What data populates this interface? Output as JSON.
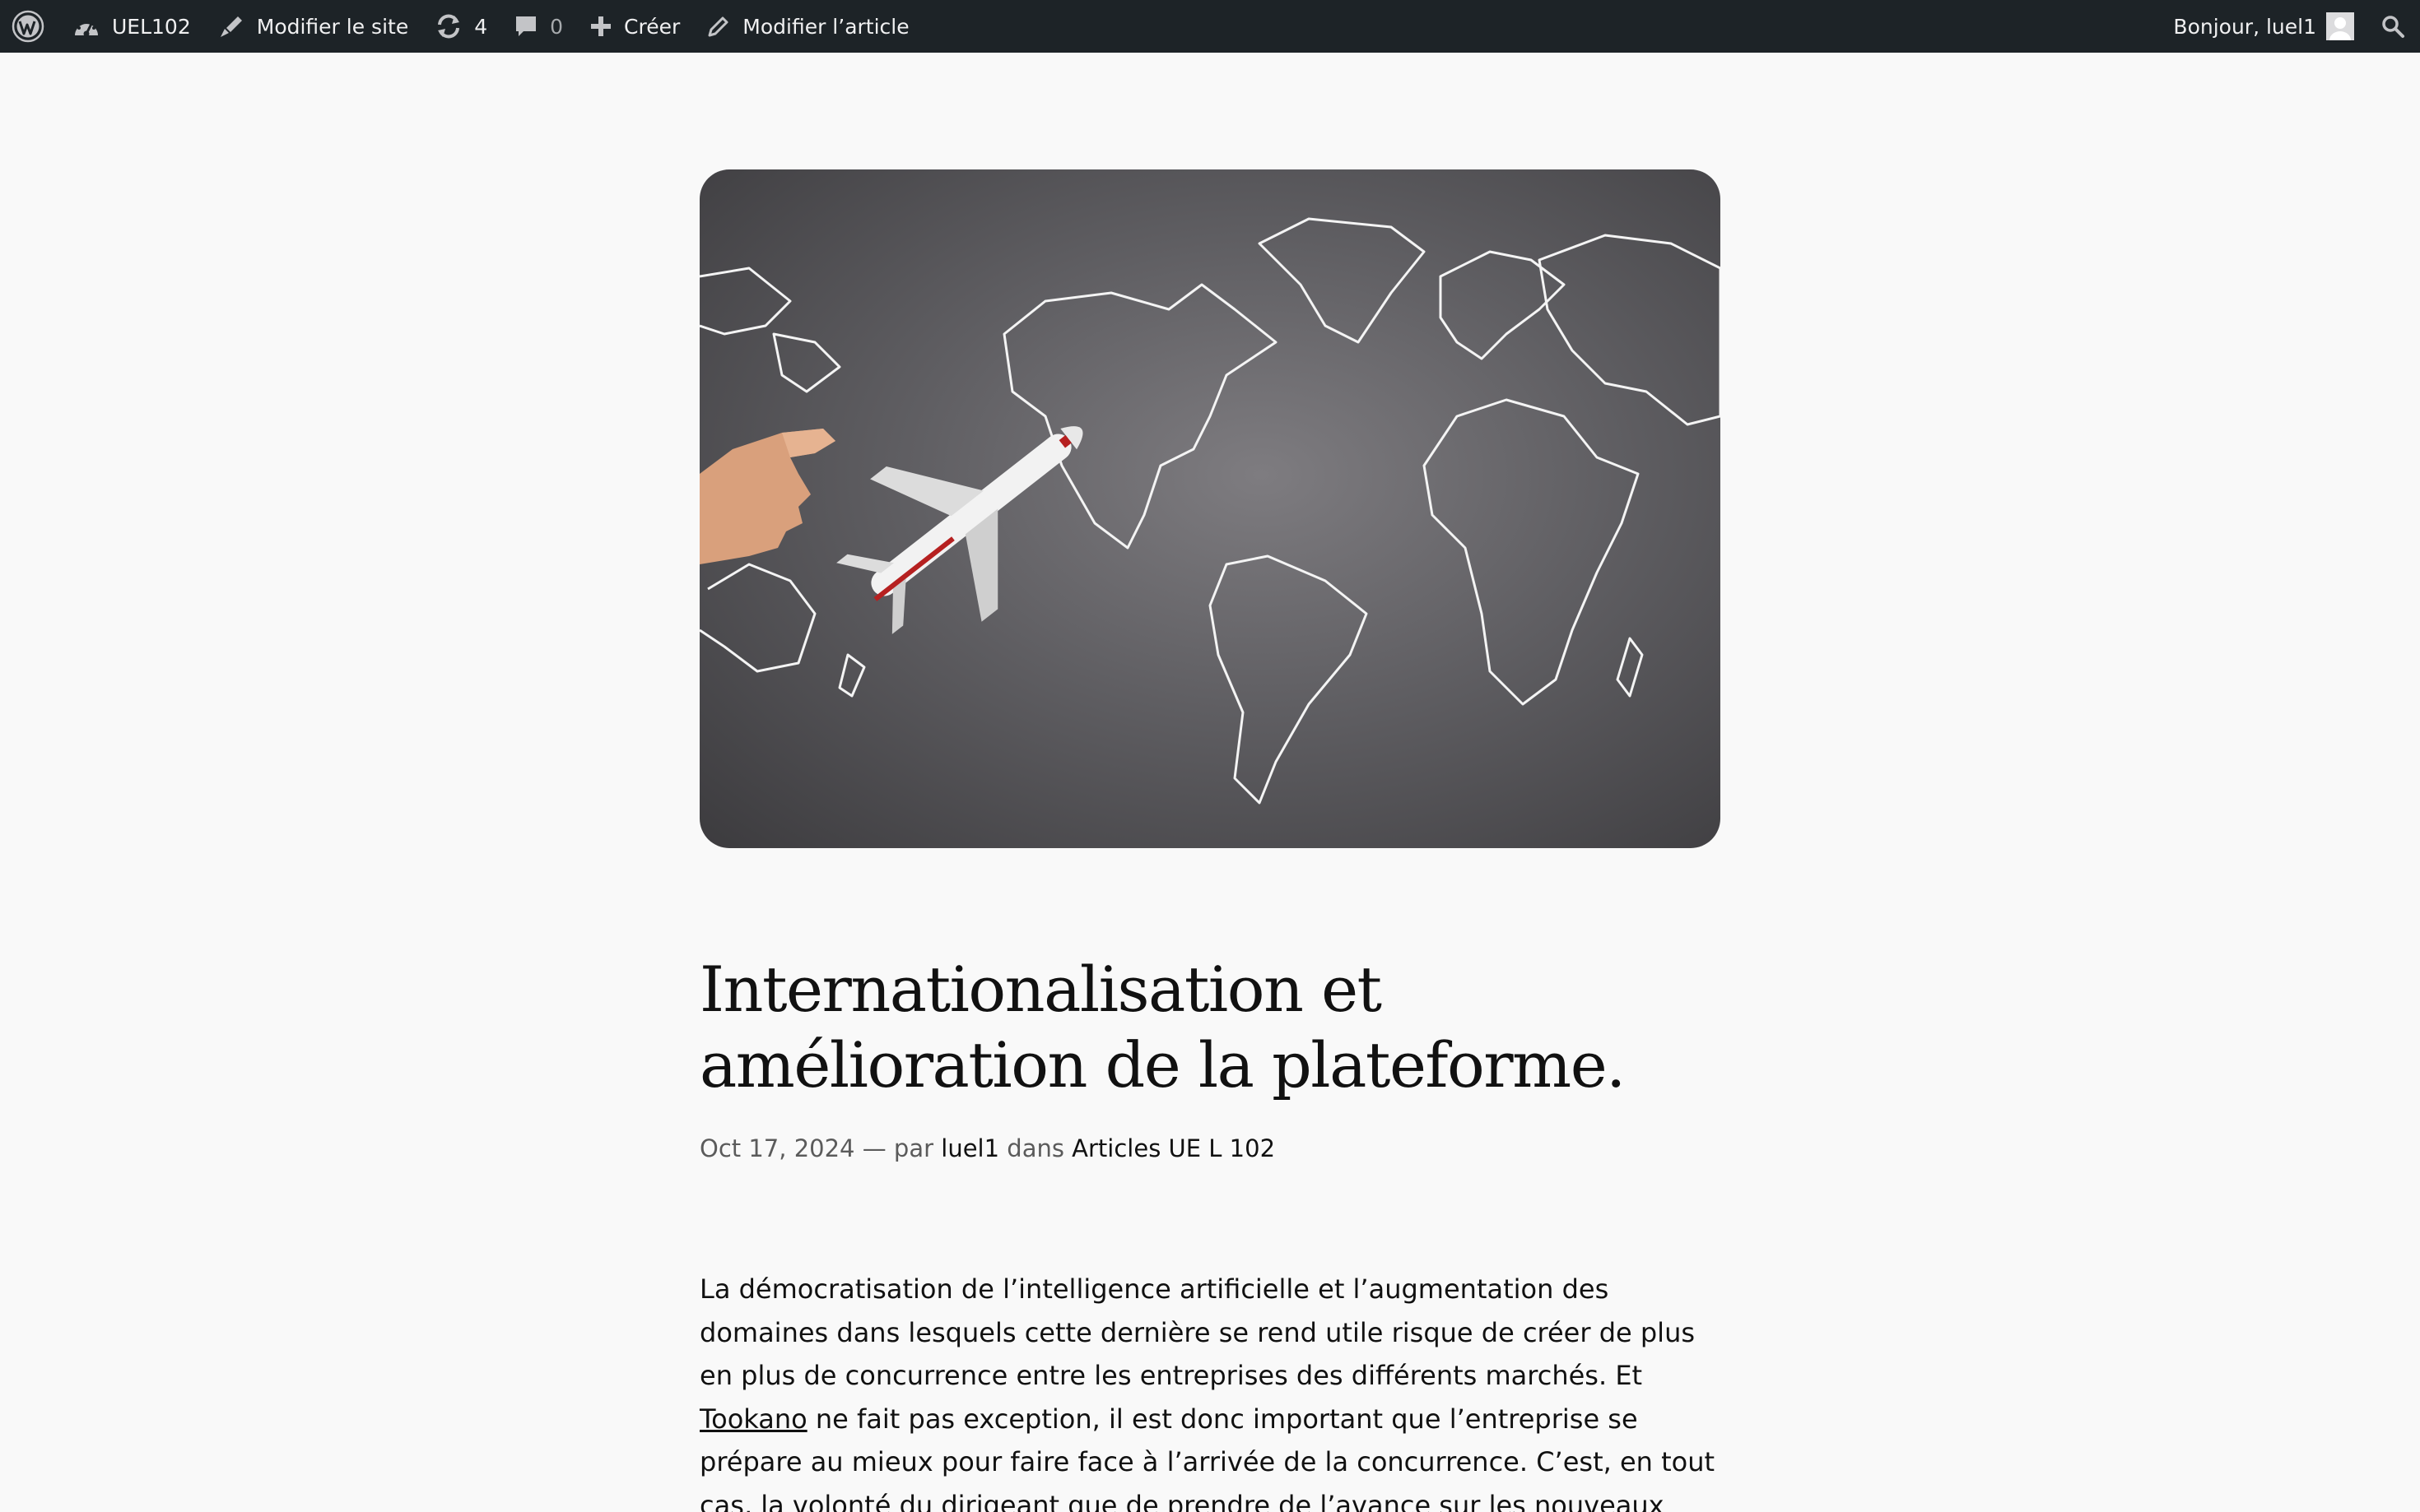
{
  "adminbar": {
    "site_name": "UEL102",
    "edit_site": "Modifier le site",
    "updates_count": "4",
    "comments_count": "0",
    "create": "Créer",
    "edit_post": "Modifier l’article",
    "greeting": "Bonjour, luel1"
  },
  "icons": {
    "wordpress": "wordpress-logo-icon",
    "dashboard": "dashboard-icon",
    "brush": "brush-icon",
    "updates": "updates-icon",
    "comments": "comment-icon",
    "plus": "plus-icon",
    "pencil": "pencil-icon",
    "search": "search-icon"
  },
  "post": {
    "title": "Internationalisation et amélioration de la plateforme.",
    "date": "Oct 17, 2024",
    "by_sep": " — par ",
    "author": "luel1",
    "in_sep": " dans ",
    "category": "Articles UE L 102",
    "body_part1": "La démocratisation de l’intelligence artificielle et l’augmentation des domaines dans lesquels cette dernière se rend utile risque de créer de plus en plus de concurrence entre les entreprises des différents marchés. Et ",
    "body_link": "Tookano",
    "body_part2": " ne fait pas exception, il est donc important que l’entreprise se prépare au mieux pour faire face à l’arrivée de la concurrence. C’est, en tout cas, la volonté du dirigeant que de prendre de l’avance sur les nouveaux arrivants (voir l’article)"
  },
  "colors": {
    "adminbar_bg": "#1d2327",
    "page_bg": "#f9f9f9",
    "text": "#111111",
    "meta": "#5b5b5b"
  }
}
